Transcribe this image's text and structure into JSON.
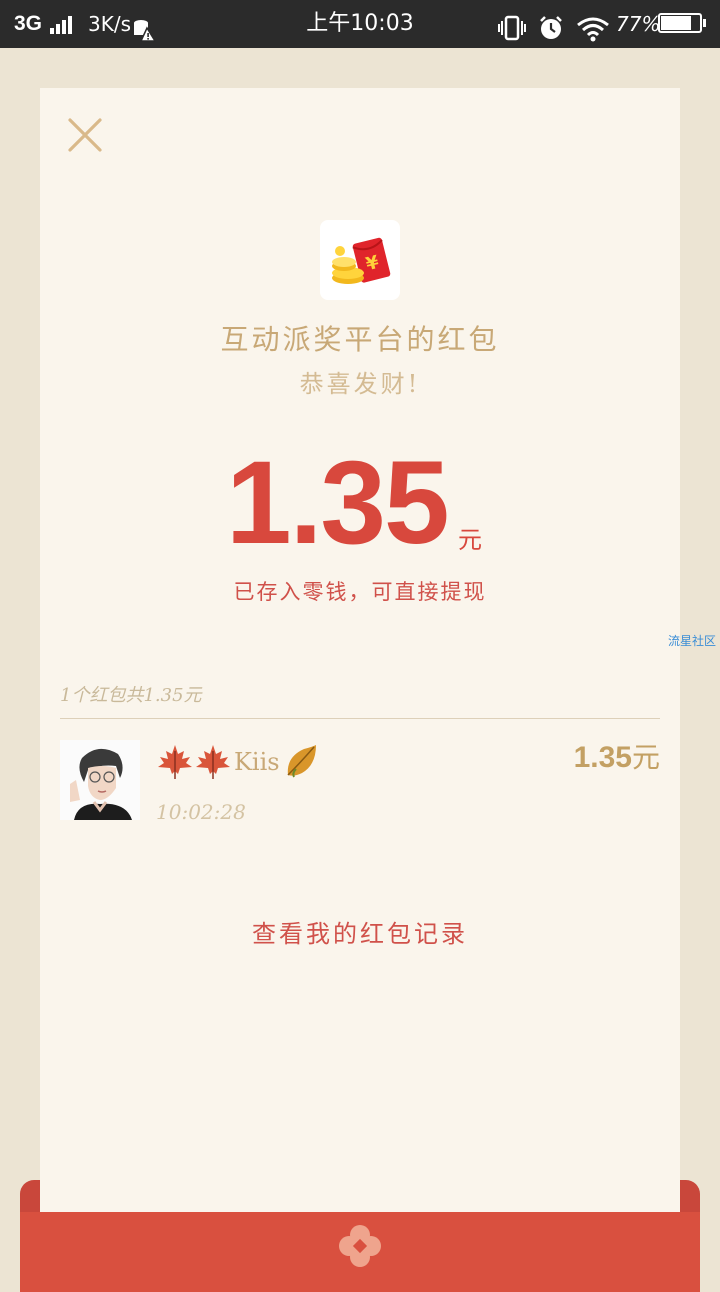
{
  "status_bar": {
    "network": "3G",
    "speed": "3K/s",
    "time": "上午10:03",
    "battery": "77%"
  },
  "envelope": {
    "sender": "互动派奖平台的红包",
    "greeting": "恭喜发财!",
    "amount": "1.35",
    "amount_unit": "元",
    "deposit_note": "已存入零钱，可直接提现",
    "summary": "1个红包共1.35元",
    "history_link": "查看我的红包记录"
  },
  "watermark": "流星社区",
  "records": [
    {
      "name": "Kiis",
      "time": "10:02:28",
      "amount": "1.35",
      "unit": "元"
    }
  ],
  "colors": {
    "accent_red": "#d8483d",
    "gold": "#c8a876",
    "card_bg": "#faf5ec",
    "page_bg": "#ece4d3"
  },
  "icons": [
    "close-icon",
    "red-packet-app-icon",
    "maple-leaf-icon",
    "autumn-leaf-icon",
    "envelope-seal-icon"
  ]
}
